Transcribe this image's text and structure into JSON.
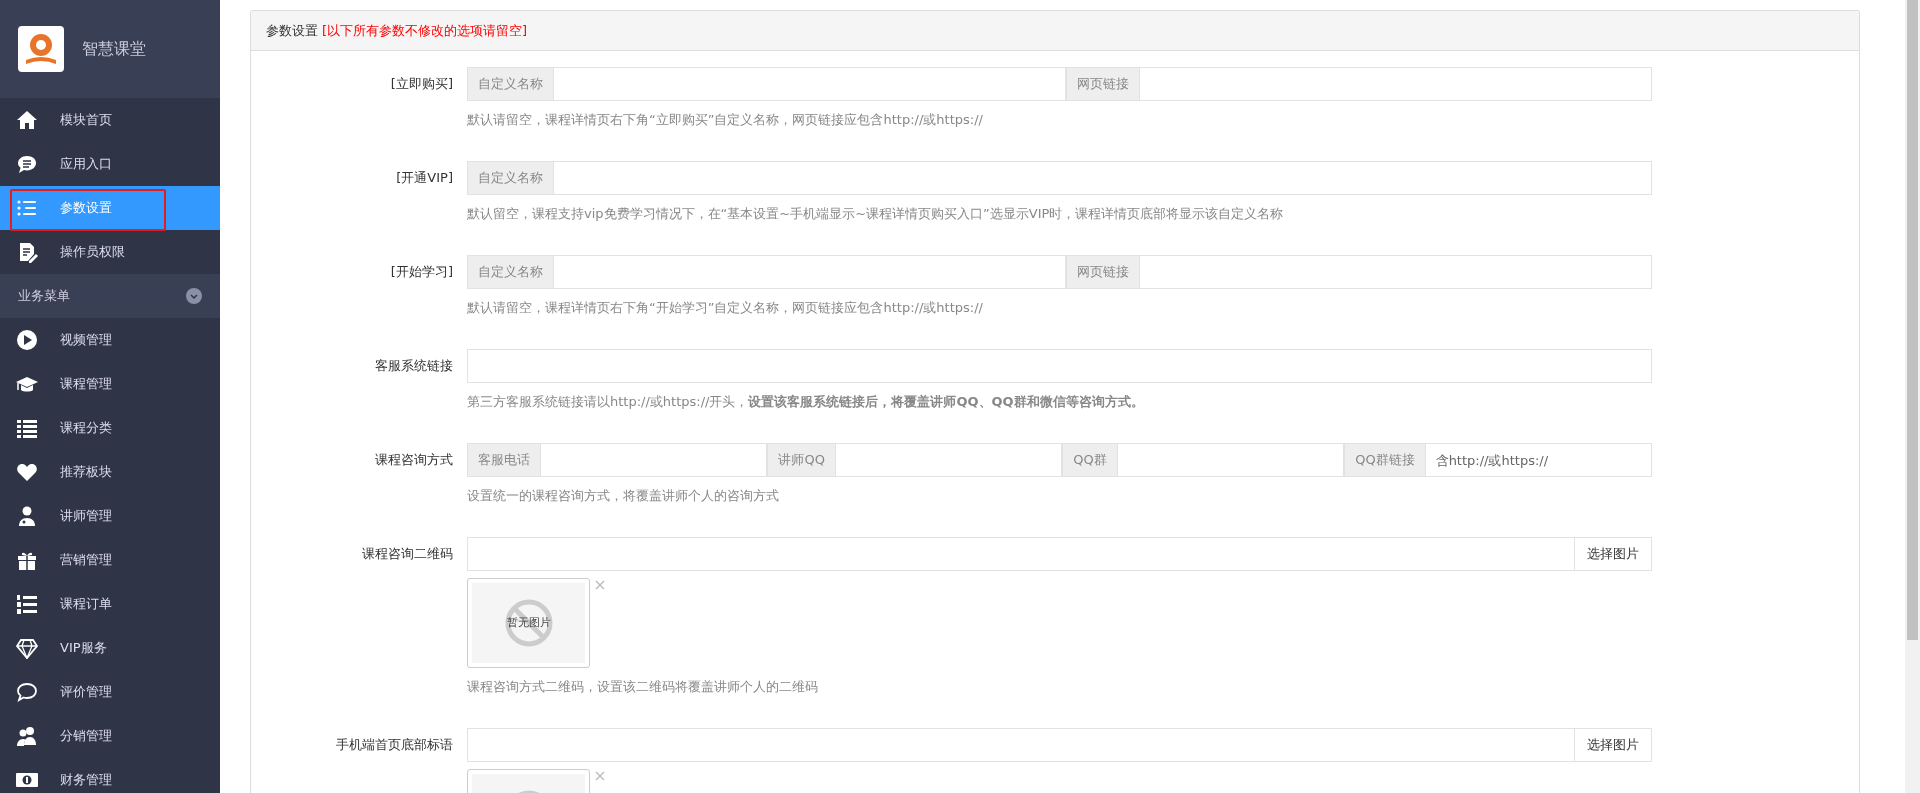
{
  "brand": {
    "name": "智慧课堂"
  },
  "sidebar": {
    "items": [
      {
        "label": "模块首页",
        "selected": false,
        "annotated": false
      },
      {
        "label": "应用入口",
        "selected": false,
        "annotated": false
      },
      {
        "label": "参数设置",
        "selected": true,
        "annotated": true
      },
      {
        "label": "操作员权限",
        "selected": false,
        "annotated": false
      }
    ],
    "section": {
      "label": "业务菜单",
      "expanded": true,
      "items": [
        {
          "label": "视频管理",
          "selected": false
        },
        {
          "label": "课程管理",
          "selected": false
        },
        {
          "label": "课程分类",
          "selected": false
        },
        {
          "label": "推荐板块",
          "selected": false
        },
        {
          "label": "讲师管理",
          "selected": false
        },
        {
          "label": "营销管理",
          "selected": false
        },
        {
          "label": "课程订单",
          "selected": false
        },
        {
          "label": "VIP服务",
          "selected": false
        },
        {
          "label": "评价管理",
          "selected": false
        },
        {
          "label": "分销管理",
          "selected": false
        },
        {
          "label": "财务管理",
          "selected": false
        }
      ]
    }
  },
  "panel": {
    "title": "参数设置",
    "note": "[以下所有参数不修改的选项请留空]",
    "fields": [
      {
        "kind": "addons",
        "label": "[立即购买]",
        "groups": [
          {
            "addon": "自定义名称"
          },
          {
            "addon": "网页链接"
          }
        ],
        "help": "默认请留空，课程详情页右下角“立即购买”自定义名称，网页链接应包含http://或https://"
      },
      {
        "kind": "addons",
        "label": "[开通VIP]",
        "groups": [
          {
            "addon": "自定义名称"
          }
        ],
        "help": "默认留空，课程支持vip免费学习情况下，在“基本设置~手机端显示~课程详情页购买入口”选显示VIP时，课程详情页底部将显示该自定义名称"
      },
      {
        "kind": "addons",
        "label": "[开始学习]",
        "groups": [
          {
            "addon": "自定义名称"
          },
          {
            "addon": "网页链接"
          }
        ],
        "help": "默认请留空，课程详情页右下角“开始学习”自定义名称，网页链接应包含http://或https://"
      },
      {
        "kind": "text",
        "label": "客服系统链接",
        "help": "第三方客服系统链接请以http://或https://开头，**设置该客服系统链接后，将覆盖讲师QQ、QQ群和微信等咨询方式。**"
      },
      {
        "kind": "addons",
        "label": "课程咨询方式",
        "groups": [
          {
            "addon": "客服电话"
          },
          {
            "addon": "讲师QQ"
          },
          {
            "addon": "QQ群"
          },
          {
            "addon": "QQ群链接",
            "placeholder": "含http://或https://"
          }
        ],
        "help": "设置统一的课程咨询方式，将覆盖讲师个人的咨询方式"
      },
      {
        "kind": "image",
        "label": "课程咨询二维码",
        "button": "选择图片",
        "preview": "暂无图片",
        "help": "课程咨询方式二维码，设置该二维码将覆盖讲师个人的二维码"
      },
      {
        "kind": "image",
        "label": "手机端首页底部标语",
        "button": "选择图片"
      }
    ]
  }
}
